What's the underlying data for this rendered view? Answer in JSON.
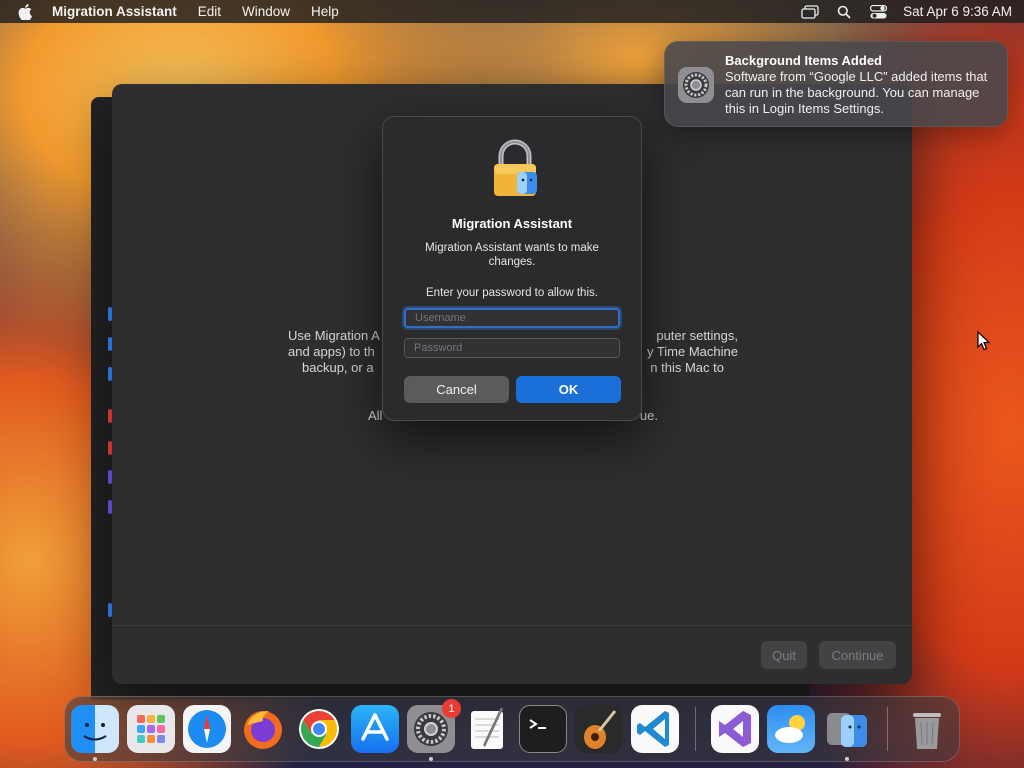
{
  "menubar": {
    "app_name": "Migration Assistant",
    "menus": [
      "Edit",
      "Window",
      "Help"
    ],
    "clock": "Sat Apr 6  9:36 AM",
    "status_icons": [
      "screen-mirroring-icon",
      "spotlight-search-icon",
      "control-center-icon"
    ]
  },
  "notification": {
    "title": "Background Items Added",
    "body": "Software from “Google LLC” added items that can run in the background. You can manage this in Login Items Settings.",
    "icon": "system-settings-icon"
  },
  "migration_window": {
    "description_partial": "Use Migration A                                    puter settings, and apps) to th                                    Time Machine backup, or a                                    n this Mac to",
    "line1_left": "Use Migration A",
    "line1_right": "puter settings,",
    "line2_left": "and apps) to th",
    "line2_right": "y Time Machine",
    "line3_left": "backup, or a",
    "line3_right": "n this Mac to",
    "line4_left": "All",
    "line4_right": "ue.",
    "quit_label": "Quit",
    "continue_label": "Continue"
  },
  "auth_dialog": {
    "title": "Migration Assistant",
    "message": "Migration Assistant wants to make changes.",
    "prompt": "Enter your password to allow this.",
    "username_placeholder": "Username",
    "password_placeholder": "Password",
    "cancel_label": "Cancel",
    "ok_label": "OK"
  },
  "dock": {
    "items": [
      {
        "name": "Finder",
        "running": true
      },
      {
        "name": "Launchpad",
        "running": false
      },
      {
        "name": "Safari",
        "running": false
      },
      {
        "name": "Firefox",
        "running": false
      },
      {
        "name": "Google Chrome",
        "running": false
      },
      {
        "name": "App Store",
        "running": false
      },
      {
        "name": "System Settings",
        "running": true,
        "badge": "1"
      },
      {
        "name": "TextEdit",
        "running": false
      },
      {
        "name": "Terminal",
        "running": false
      },
      {
        "name": "GarageBand",
        "running": false
      },
      {
        "name": "Visual Studio Code",
        "running": false
      },
      {
        "name": "Visual Studio",
        "running": false
      },
      {
        "name": "Weather",
        "running": false
      },
      {
        "name": "Migration Assistant",
        "running": true
      },
      {
        "name": "Trash",
        "running": false
      }
    ]
  }
}
